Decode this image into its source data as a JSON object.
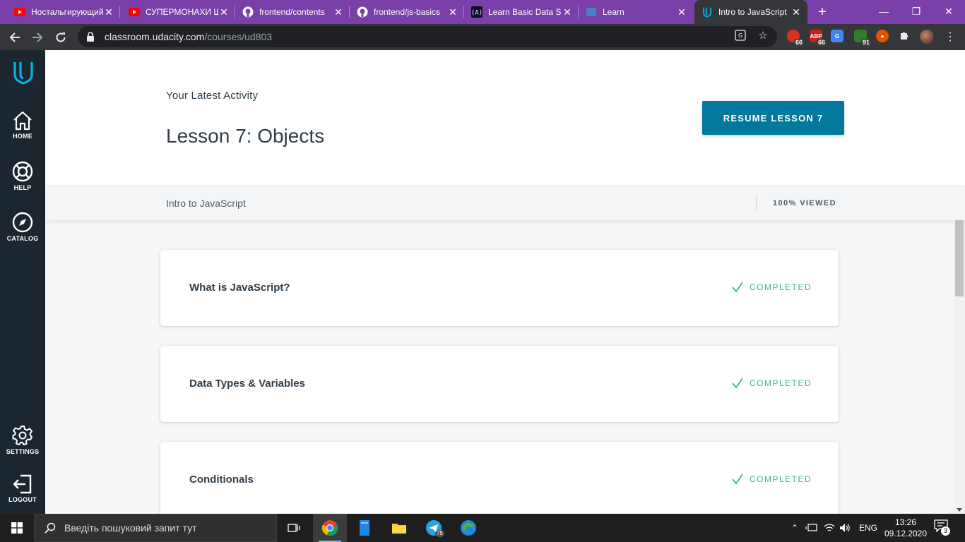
{
  "browser": {
    "tabs": [
      {
        "title": "Ностальгирующий",
        "favicon": "youtube-icon"
      },
      {
        "title": "СУПЕРМОНАХИ Ш",
        "favicon": "youtube-icon"
      },
      {
        "title": "frontend/contents",
        "favicon": "github-icon"
      },
      {
        "title": "frontend/js-basics",
        "favicon": "github-icon"
      },
      {
        "title": "Learn Basic Data St",
        "favicon": "freecodecamp-icon"
      },
      {
        "title": "Learn",
        "favicon": "page-icon"
      },
      {
        "title": "Intro to JavaScript",
        "favicon": "udacity-icon"
      }
    ],
    "active_tab": 6,
    "url_host": "classroom.udacity.com",
    "url_path": "/courses/ud803",
    "extension_badges": [
      "66",
      "66",
      "91"
    ]
  },
  "sidebar": {
    "items": [
      {
        "label": "HOME",
        "icon": "home-icon"
      },
      {
        "label": "HELP",
        "icon": "lifebuoy-icon"
      },
      {
        "label": "CATALOG",
        "icon": "compass-icon"
      },
      {
        "label": "SETTINGS",
        "icon": "gear-icon"
      },
      {
        "label": "LOGOUT",
        "icon": "logout-icon"
      }
    ]
  },
  "header": {
    "activity_label": "Your Latest Activity",
    "lesson_title": "Lesson 7: Objects",
    "resume_button": "RESUME LESSON 7",
    "course_name": "Intro to JavaScript",
    "viewed": "100% VIEWED"
  },
  "lessons": [
    {
      "title": "What is JavaScript?",
      "status": "COMPLETED"
    },
    {
      "title": "Data Types & Variables",
      "status": "COMPLETED"
    },
    {
      "title": "Conditionals",
      "status": "COMPLETED"
    }
  ],
  "taskbar": {
    "search_placeholder": "Введіть пошуковий запит тут",
    "telegram_badge": "75",
    "language": "ENG",
    "time": "13:26",
    "date": "09.12.2020",
    "notification_count": "3"
  },
  "colors": {
    "accent": "#02789c",
    "completed": "#3bb59f",
    "rail": "#1c262f",
    "logo": "#02b3e4"
  }
}
